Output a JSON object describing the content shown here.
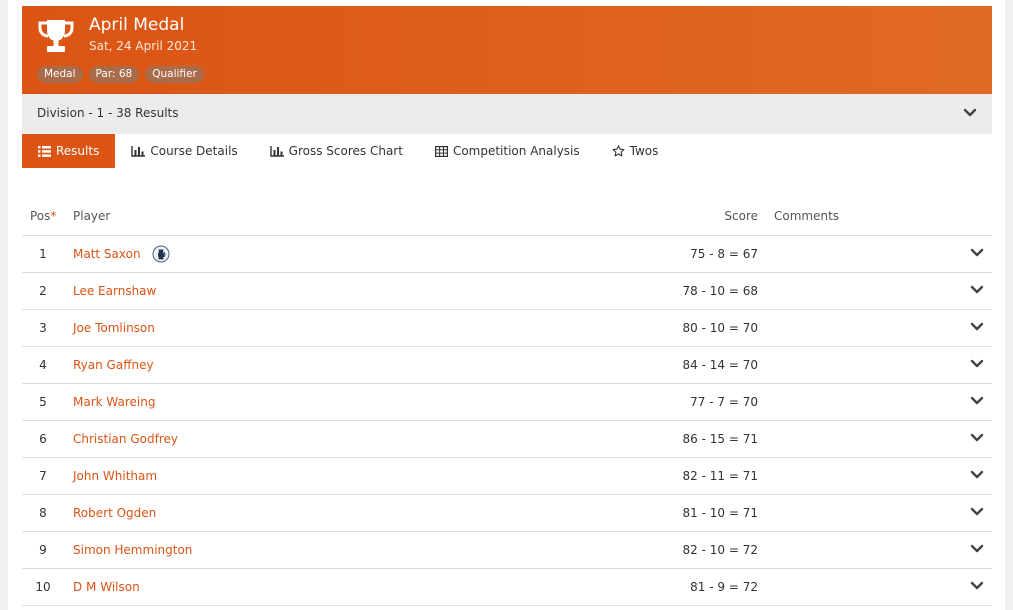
{
  "competition": {
    "title": "April Medal",
    "date": "Sat, 24 April 2021",
    "tags": [
      "Medal",
      "Par: 68",
      "Qualifier"
    ],
    "accent_color": "#db5414"
  },
  "division": {
    "label": "Division - 1 - 38 Results"
  },
  "tabs": [
    {
      "label": "Results",
      "icon": "list-icon",
      "active": true
    },
    {
      "label": "Course Details",
      "icon": "bar-chart-icon",
      "active": false
    },
    {
      "label": "Gross Scores Chart",
      "icon": "bar-chart-icon",
      "active": false
    },
    {
      "label": "Competition Analysis",
      "icon": "table-icon",
      "active": false
    },
    {
      "label": "Twos",
      "icon": "star-icon",
      "active": false
    }
  ],
  "table": {
    "headers": {
      "pos": "Pos",
      "pos_marker": "*",
      "player": "Player",
      "score": "Score",
      "comments": "Comments"
    },
    "rows": [
      {
        "pos": "1",
        "player": "Matt Saxon",
        "score": "75 - 8 = 67",
        "badge": "claret-jug-icon"
      },
      {
        "pos": "2",
        "player": "Lee Earnshaw",
        "score": "78 - 10 = 68"
      },
      {
        "pos": "3",
        "player": "Joe Tomlinson",
        "score": "80 - 10 = 70"
      },
      {
        "pos": "4",
        "player": "Ryan Gaffney",
        "score": "84 - 14 = 70"
      },
      {
        "pos": "5",
        "player": "Mark Wareing",
        "score": "77 - 7 = 70"
      },
      {
        "pos": "6",
        "player": "Christian Godfrey",
        "score": "86 - 15 = 71"
      },
      {
        "pos": "7",
        "player": "John Whitham",
        "score": "82 - 11 = 71"
      },
      {
        "pos": "8",
        "player": "Robert Ogden",
        "score": "81 - 10 = 71"
      },
      {
        "pos": "9",
        "player": "Simon Hemmington",
        "score": "82 - 10 = 72"
      },
      {
        "pos": "10",
        "player": "D M Wilson",
        "score": "81 - 9 = 72"
      }
    ]
  }
}
